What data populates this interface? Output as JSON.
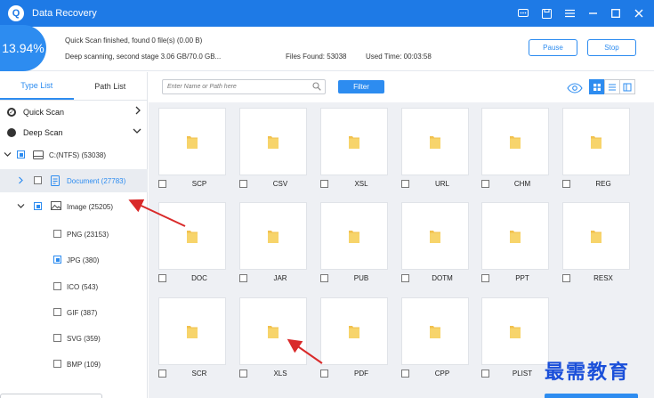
{
  "window": {
    "title": "Data Recovery",
    "accent_color": "#1e7ae6"
  },
  "status": {
    "percent": "13.94%",
    "progress_fraction": 0.1394,
    "line1": "Quick Scan finished, found 0 file(s) (0.00  B)",
    "line2": "Deep scanning, second stage 3.06 GB/70.0 GB...",
    "files_found": "Files Found: 53038",
    "used_time": "Used Time: 00:03:58",
    "pause_label": "Pause",
    "stop_label": "Stop"
  },
  "sidebar": {
    "tabs": [
      "Type List",
      "Path List"
    ],
    "quick_scan": "Quick Scan",
    "deep_scan": "Deep Scan",
    "drive": "C:(NTFS) (53038)",
    "document": "Document (27783)",
    "image": "Image (25205)",
    "image_types": [
      "PNG (23153)",
      "JPG (380)",
      "ICO (543)",
      "GIF (387)",
      "SVG (359)",
      "BMP (109)"
    ]
  },
  "toolbar": {
    "search_placeholder": "Enter Name or Path here",
    "filter_label": "Filter"
  },
  "grid": {
    "items": [
      "SCP",
      "CSV",
      "XSL",
      "URL",
      "CHM",
      "REG",
      "DOC",
      "JAR",
      "PUB",
      "DOTM",
      "PPT",
      "RESX",
      "SCR",
      "XLS",
      "PDF",
      "CPP",
      "PLIST"
    ]
  },
  "watermark": "最需教育"
}
